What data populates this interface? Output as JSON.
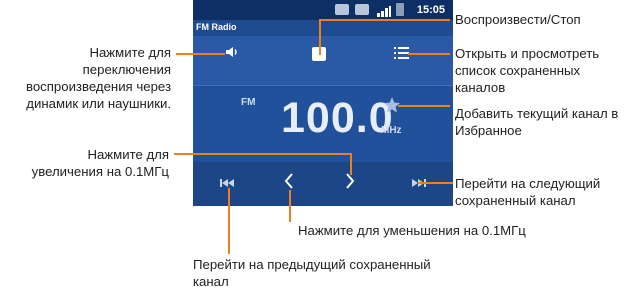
{
  "app": {
    "title": "FM Radio"
  },
  "status": {
    "time": "15:05"
  },
  "radio": {
    "band": "FM",
    "frequency": "100.0",
    "unit": "MHz"
  },
  "icons": {
    "speaker": "speaker-icon",
    "stop": "stop-icon",
    "list": "channel-list-icon",
    "favorite": "star-icon",
    "prev_channel": "previous-channel-icon",
    "step_down": "chevron-left-icon",
    "step_up": "chevron-right-icon",
    "next_channel": "next-channel-icon"
  },
  "colors": {
    "accent": "#f07e1c",
    "screen": "#22519b"
  },
  "annotations": {
    "speaker": [
      "Нажмите для",
      "переключения",
      "воспроизведения через",
      "динамик или наушники."
    ],
    "stop": [
      "Воспроизвести/Стоп"
    ],
    "list": [
      "Открыть и просмотреть",
      "список сохраненных",
      "каналов"
    ],
    "favorite": [
      "Добавить текущий канал в",
      "Избранное"
    ],
    "step_up": [
      "Нажмите для",
      "увеличения на 0.1МГц"
    ],
    "next_channel": [
      "Перейти на следующий",
      "сохраненный канал"
    ],
    "step_down": [
      "Нажмите для уменьшения на 0.1МГц"
    ],
    "prev_channel": [
      "Перейти на предыдущий сохраненный",
      "канал"
    ]
  }
}
